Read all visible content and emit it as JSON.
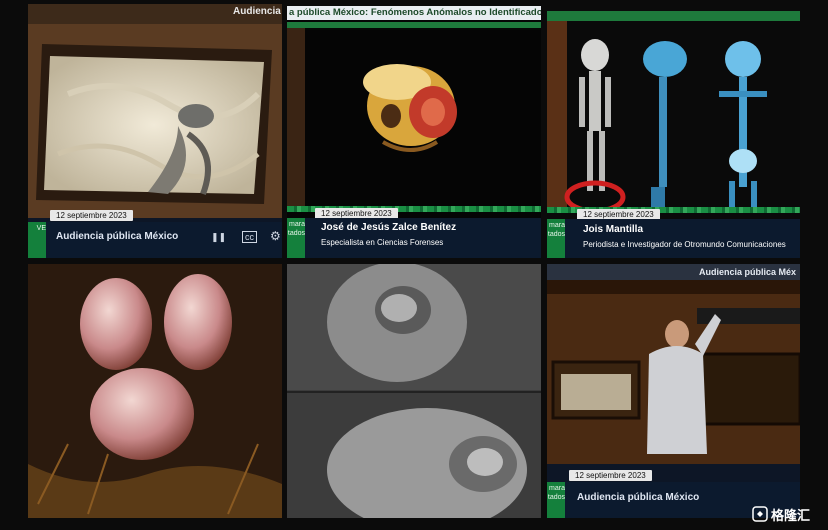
{
  "tiles": {
    "t1": {
      "top_label": "Audiencia",
      "date": "12 septiembre 2023",
      "side_tab": "VE",
      "title": "Audiencia pública México"
    },
    "t2": {
      "top_title": "a pública México: Fenómenos Anómalos no Identificado",
      "date": "12 septiembre 2023",
      "side_tab": "mara\ntados",
      "name": "José de Jesús Zalce Benítez",
      "role": "Especialista en Ciencias Forenses"
    },
    "t3": {
      "date": "12 septiembre 2023",
      "side_tab": "mara\ntados",
      "name": "Jois Mantilla",
      "role": "Periodista e Investigador de Otromundo Comunicaciones"
    },
    "t6": {
      "top_label": "Audiencia pública Méx",
      "date": "12 septiembre 2023",
      "side_tab": "mara\ntados",
      "title": "Audiencia pública México"
    }
  },
  "watermark": "格隆汇",
  "colors": {
    "background": "#0b0b0b",
    "lower_third": "#0c1a2e",
    "congress_green": "#14803c"
  }
}
